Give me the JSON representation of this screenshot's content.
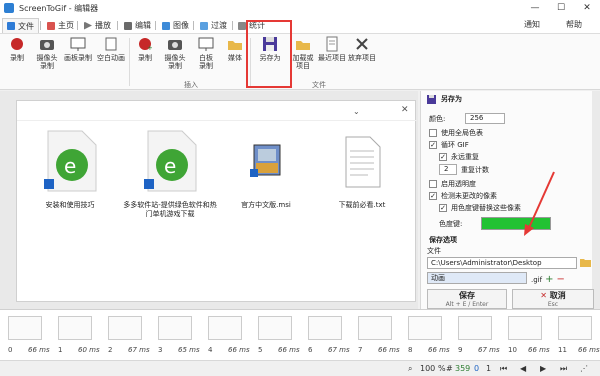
{
  "window": {
    "title": "ScreenToGif - 编辑器",
    "minimize": "—",
    "maximize": "☐",
    "close": "✕"
  },
  "tabs": [
    {
      "label": "文件",
      "color": "#2e7bd6"
    },
    {
      "label": "主页",
      "color": "#2e7bd6"
    },
    {
      "label": "播放",
      "color": "#2e7bd6"
    },
    {
      "label": "编辑",
      "color": "#2e7bd6"
    },
    {
      "label": "图像",
      "color": "#2e7bd6"
    },
    {
      "label": "过渡",
      "color": "#2e7bd6"
    },
    {
      "label": "统计",
      "color": "#2e7bd6"
    }
  ],
  "header_right": {
    "notifications": "通知",
    "help": "帮助"
  },
  "ribbon": {
    "group1": [
      {
        "label": "录制",
        "icon": "record-icon"
      },
      {
        "label": "摄像头\n录制",
        "icon": "camera-icon"
      },
      {
        "label": "画板录制",
        "icon": "board-icon"
      },
      {
        "label": "空白动画",
        "icon": "blank-icon"
      }
    ],
    "group2": [
      {
        "label": "录制",
        "icon": "record-icon"
      },
      {
        "label": "摄像头\n录制",
        "icon": "camera-icon"
      },
      {
        "label": "白板\n录制",
        "icon": "board-icon"
      },
      {
        "label": "媒体",
        "icon": "folder-icon"
      }
    ],
    "group2_label": "插入",
    "group3": [
      {
        "label": "另存为",
        "icon": "save-as-icon"
      },
      {
        "label": "加载或\n项目",
        "icon": "load-icon"
      },
      {
        "label": "最近项目",
        "icon": "recent-icon"
      },
      {
        "label": "放弃项目",
        "icon": "discard-icon"
      }
    ],
    "group3_label": "文件"
  },
  "explorer": {
    "dropdown": "⌄",
    "close": "✕",
    "files": [
      {
        "label": "安装和使用技巧"
      },
      {
        "label": "多多软件站-提供绿色软件和热门单机游戏下载"
      },
      {
        "label": "官方中文版.msi"
      },
      {
        "label": "下载前必看.txt"
      }
    ]
  },
  "right_panel": {
    "header": "另存为",
    "color_label": "颜色:",
    "color_value": "256",
    "use_global_palette": "使用全局色表",
    "loop_gif": "循环 GIF",
    "repeat_forever": "永远重复",
    "repeat_count_value": "2",
    "repeat_count_label": "重复计数",
    "enable_transparency": "启用透明度",
    "detect_unchanged": "检测未更改的像素",
    "replace_with_color": "用色度键替换这些像素",
    "chroma_label": "色度键:",
    "chroma_color": "#22c233",
    "save_options": "保存选项",
    "file_label": "文件",
    "path_value": "C:\\Users\\Administrator\\Desktop",
    "name_value": "动画",
    "extension": ".gif",
    "save_button": "保存",
    "save_shortcut": "Alt + E / Enter",
    "cancel_button": "取消",
    "cancel_shortcut": "Esc"
  },
  "timeline": {
    "frames": [
      {
        "num": "0",
        "ms": "66 ms"
      },
      {
        "num": "1",
        "ms": "60 ms"
      },
      {
        "num": "2",
        "ms": "67 ms"
      },
      {
        "num": "3",
        "ms": "65 ms"
      },
      {
        "num": "4",
        "ms": "66 ms"
      },
      {
        "num": "5",
        "ms": "66 ms"
      },
      {
        "num": "6",
        "ms": "67 ms"
      },
      {
        "num": "7",
        "ms": "66 ms"
      },
      {
        "num": "8",
        "ms": "66 ms"
      },
      {
        "num": "9",
        "ms": "67 ms"
      },
      {
        "num": "10",
        "ms": "66 ms"
      },
      {
        "num": "11",
        "ms": "66 ms"
      }
    ]
  },
  "status": {
    "zoom": "100",
    "zoom_unit": "%",
    "frame_total": "359",
    "frame_selected": "0",
    "frame_current": "1"
  }
}
